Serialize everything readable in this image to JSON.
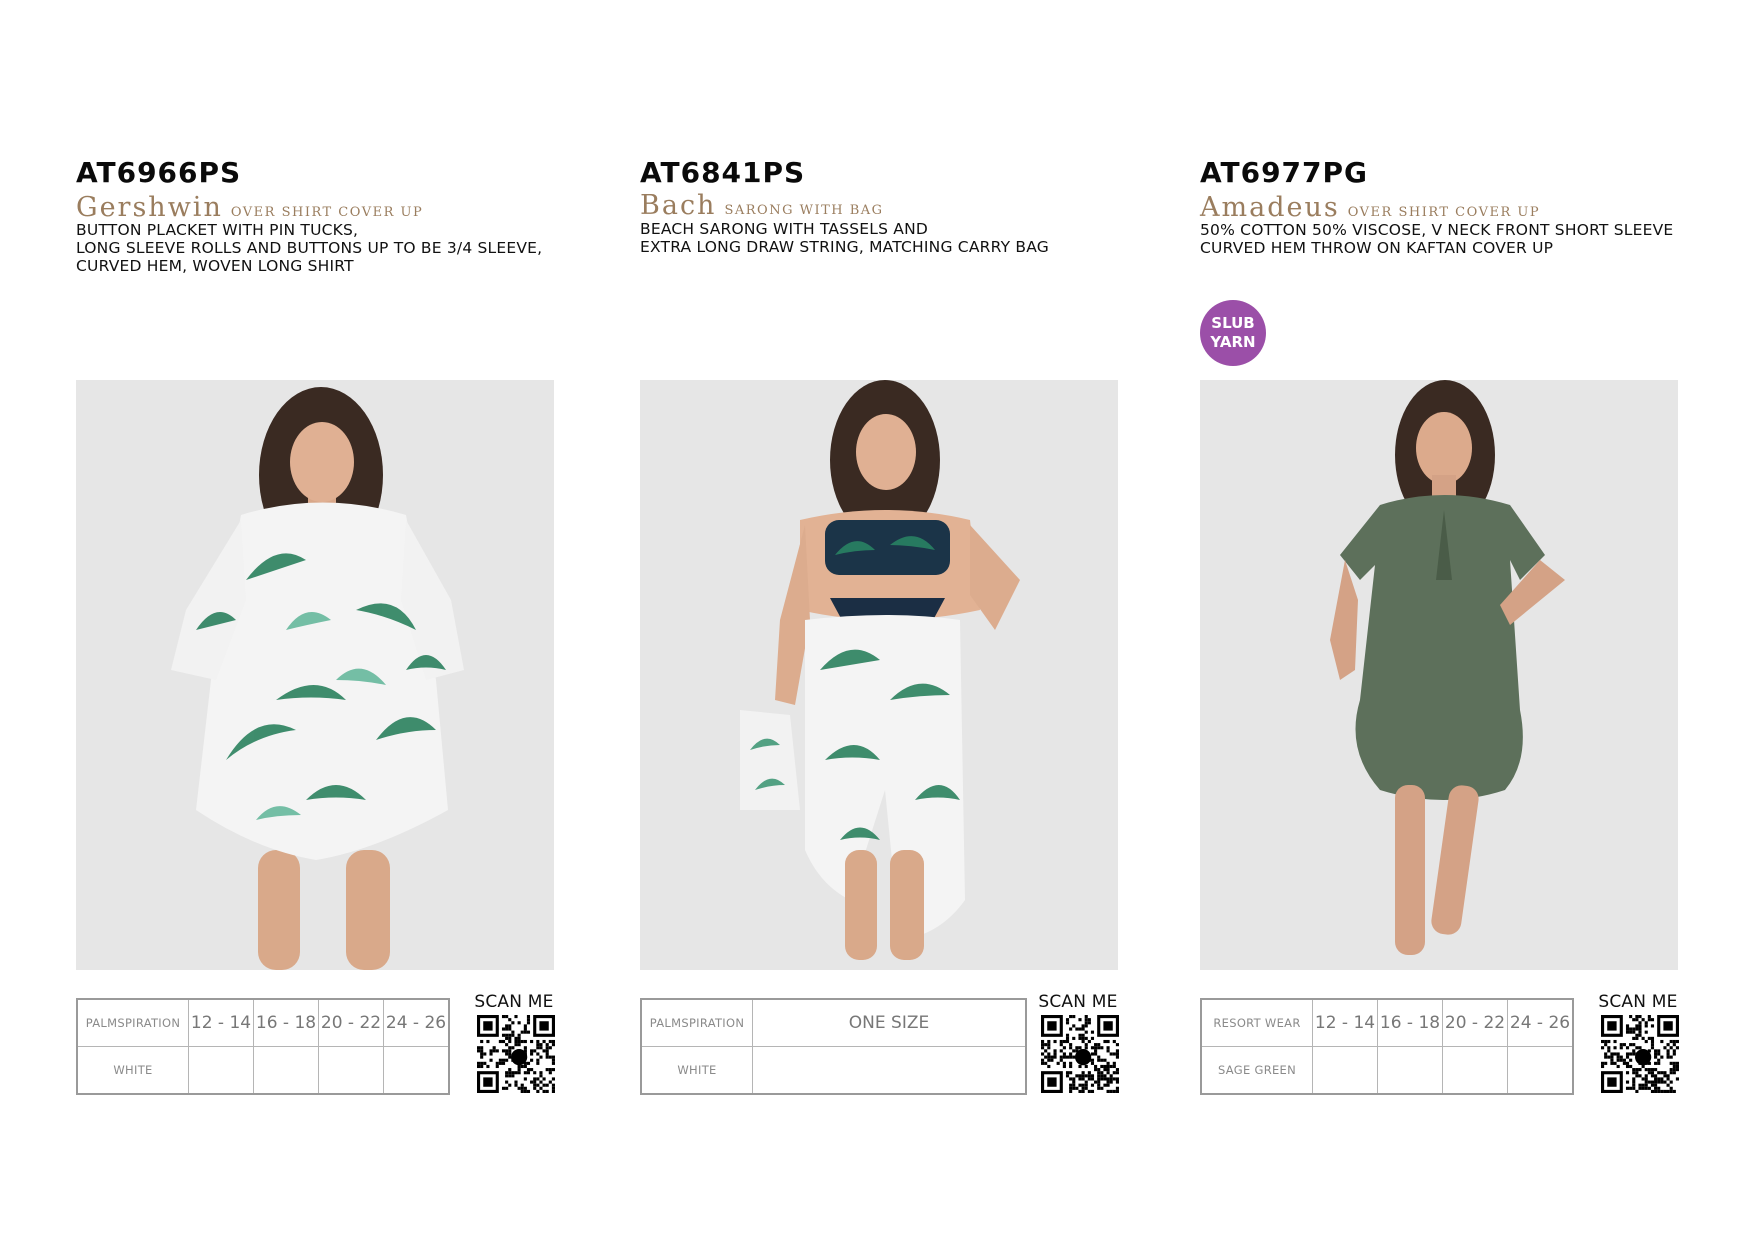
{
  "products": [
    {
      "code": "AT6966PS",
      "name": "Gershwin",
      "subtitle": "OVER SHIRT COVER UP",
      "description": [
        "BUTTON PLACKET WITH PIN TUCKS,",
        "LONG SLEEVE ROLLS AND BUTTONS UP TO BE 3/4 SLEEVE,",
        "CURVED HEM, WOVEN LONG SHIRT"
      ],
      "print_name": "PALMSPIRATION",
      "sizes": [
        "12 - 14",
        "16 - 18",
        "20 - 22",
        "24 - 26"
      ],
      "colour": "WHITE",
      "scan_label": "SCAN ME"
    },
    {
      "code": "AT6841PS",
      "name": "Bach",
      "subtitle": "SARONG WITH BAG",
      "description": [
        "BEACH SARONG WITH TASSELS AND",
        "EXTRA LONG DRAW STRING, MATCHING CARRY BAG"
      ],
      "print_name": "PALMSPIRATION",
      "sizes": [
        "ONE SIZE"
      ],
      "colour": "WHITE",
      "scan_label": "SCAN ME"
    },
    {
      "code": "AT6977PG",
      "name": "Amadeus",
      "subtitle": "OVER SHIRT COVER UP",
      "description": [
        "50% COTTON 50% VISCOSE, V NECK FRONT SHORT SLEEVE",
        "CURVED HEM THROW ON KAFTAN COVER UP"
      ],
      "badge": [
        "SLUB",
        "YARN"
      ],
      "print_name": "RESORT WEAR",
      "sizes": [
        "12 - 14",
        "16 - 18",
        "20 - 22",
        "24 - 26"
      ],
      "colour": "SAGE GREEN",
      "scan_label": "SCAN ME"
    }
  ],
  "colors": {
    "name_accent": "#9a7d5e",
    "badge": "#9b4fa8",
    "photo_bg": "#e5e5e5",
    "palm_green": "#1f7a55",
    "sage_green": "#5a6e58"
  },
  "icons": {
    "qr": "qr-code-icon"
  }
}
